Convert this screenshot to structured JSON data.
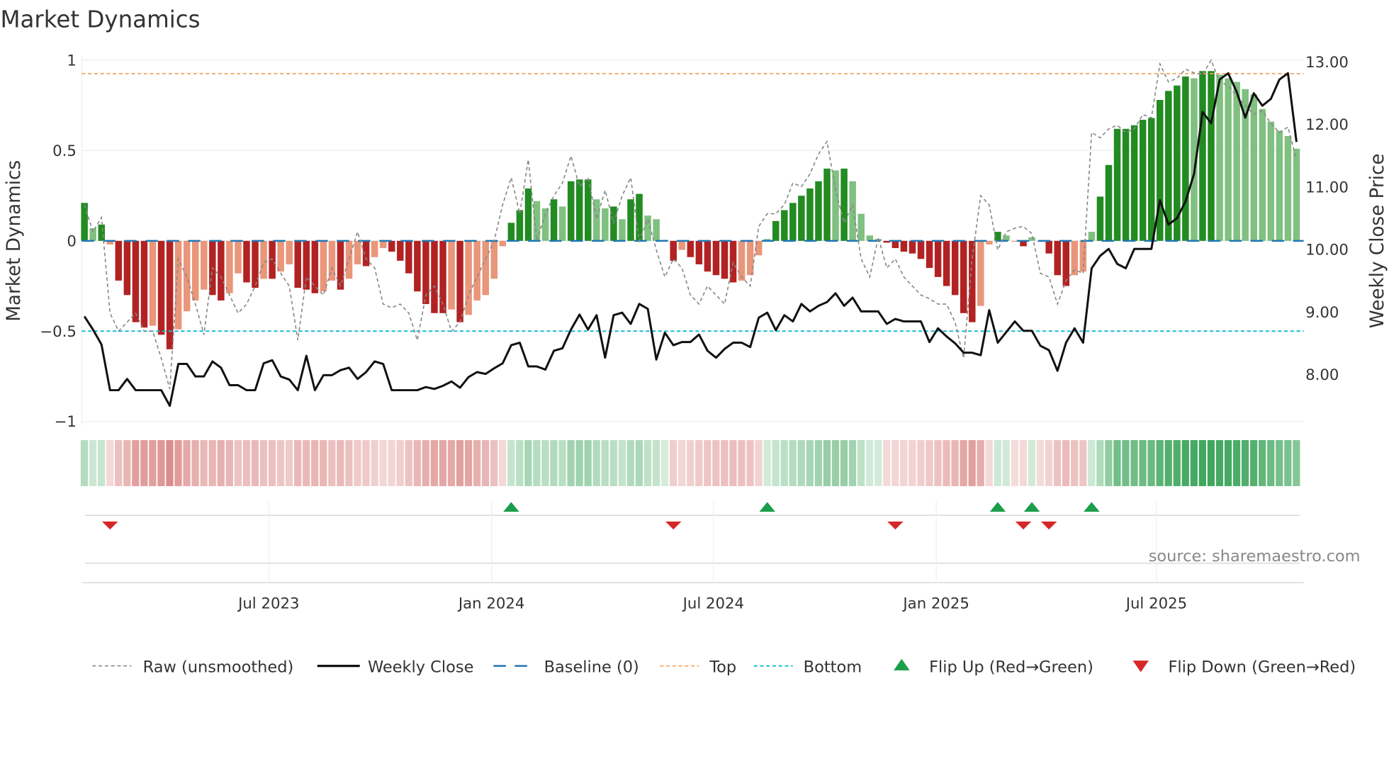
{
  "chart_data": {
    "type": "bar",
    "title": "Market Dynamics",
    "ylabel": "Market Dynamics",
    "y2label": "Weekly Close Price",
    "ylim": [
      -1,
      1
    ],
    "y2lim": [
      7.0,
      13.0
    ],
    "yticks": [
      {
        "v": 1,
        "label": "1"
      },
      {
        "v": 0.5,
        "label": "0.5"
      },
      {
        "v": 0,
        "label": "0"
      },
      {
        "v": -0.5,
        "label": "−0.5"
      },
      {
        "v": -1,
        "label": "−1"
      }
    ],
    "y2ticks": [
      {
        "v": 13,
        "label": "13.00"
      },
      {
        "v": 12,
        "label": "12.00"
      },
      {
        "v": 11,
        "label": "11.00"
      },
      {
        "v": 10,
        "label": "10.00"
      },
      {
        "v": 9,
        "label": "9.00"
      },
      {
        "v": 8,
        "label": "8.00"
      }
    ],
    "xticks": [
      {
        "week": 21.6,
        "label": "Jul 2023"
      },
      {
        "week": 47.7,
        "label": "Jan 2024"
      },
      {
        "week": 73.7,
        "label": "Jul 2024"
      },
      {
        "week": 99.8,
        "label": "Jan 2025"
      },
      {
        "week": 125.6,
        "label": "Jul 2025"
      }
    ],
    "levels": {
      "top": 0.926,
      "bottom": -0.5,
      "baseline": 0
    },
    "market_dynamics": [
      0.21,
      0.07,
      0.09,
      -0.02,
      -0.22,
      -0.3,
      -0.45,
      -0.48,
      -0.47,
      -0.52,
      -0.6,
      -0.49,
      -0.39,
      -0.33,
      -0.27,
      -0.3,
      -0.33,
      -0.29,
      -0.18,
      -0.23,
      -0.26,
      -0.21,
      -0.21,
      -0.17,
      -0.13,
      -0.26,
      -0.27,
      -0.29,
      -0.28,
      -0.22,
      -0.27,
      -0.21,
      -0.13,
      -0.14,
      -0.09,
      -0.04,
      -0.06,
      -0.11,
      -0.18,
      -0.28,
      -0.35,
      -0.4,
      -0.4,
      -0.38,
      -0.45,
      -0.41,
      -0.33,
      -0.3,
      -0.21,
      -0.03,
      0.1,
      0.17,
      0.29,
      0.22,
      0.18,
      0.23,
      0.19,
      0.33,
      0.34,
      0.34,
      0.23,
      0.18,
      0.19,
      0.12,
      0.23,
      0.26,
      0.14,
      0.12,
      0.005,
      -0.11,
      -0.05,
      -0.09,
      -0.13,
      -0.17,
      -0.19,
      -0.21,
      -0.23,
      -0.22,
      -0.19,
      -0.08,
      0.01,
      0.11,
      0.17,
      0.21,
      0.25,
      0.29,
      0.33,
      0.4,
      0.39,
      0.4,
      0.33,
      0.15,
      0.03,
      0.01,
      -0.01,
      -0.04,
      -0.06,
      -0.07,
      -0.1,
      -0.15,
      -0.2,
      -0.25,
      -0.3,
      -0.4,
      -0.45,
      -0.36,
      -0.02,
      0.05,
      0.03,
      -0.005,
      -0.03,
      0.02,
      -0.005,
      -0.07,
      -0.19,
      -0.25,
      -0.19,
      -0.17,
      0.05,
      0.245,
      0.42,
      0.62,
      0.62,
      0.64,
      0.67,
      0.68,
      0.78,
      0.83,
      0.86,
      0.91,
      0.9,
      0.94,
      0.94,
      0.92,
      0.9,
      0.88,
      0.84,
      0.81,
      0.73,
      0.66,
      0.61,
      0.58,
      0.51
    ],
    "raw": [
      0.2,
      0.05,
      0.13,
      -0.4,
      -0.5,
      -0.45,
      -0.4,
      -0.5,
      -0.5,
      -0.65,
      -0.82,
      -0.1,
      -0.2,
      -0.35,
      -0.52,
      -0.15,
      -0.2,
      -0.3,
      -0.4,
      -0.35,
      -0.25,
      -0.12,
      -0.1,
      -0.18,
      -0.25,
      -0.55,
      -0.2,
      -0.25,
      -0.3,
      -0.15,
      -0.25,
      -0.1,
      0.05,
      -0.1,
      -0.15,
      -0.35,
      -0.37,
      -0.35,
      -0.4,
      -0.55,
      -0.3,
      -0.25,
      -0.35,
      -0.5,
      -0.45,
      -0.3,
      -0.2,
      -0.1,
      0.0,
      0.2,
      0.35,
      0.15,
      0.45,
      0.0,
      0.15,
      0.25,
      0.32,
      0.47,
      0.3,
      0.35,
      0.12,
      0.28,
      0.1,
      0.25,
      0.35,
      0.0,
      0.12,
      -0.05,
      -0.2,
      -0.1,
      -0.15,
      -0.3,
      -0.35,
      -0.25,
      -0.3,
      -0.35,
      -0.12,
      -0.2,
      -0.25,
      0.08,
      0.15,
      0.15,
      0.2,
      0.32,
      0.3,
      0.37,
      0.48,
      0.55,
      0.28,
      0.1,
      0.2,
      -0.1,
      -0.2,
      0.02,
      -0.15,
      -0.1,
      -0.2,
      -0.25,
      -0.3,
      -0.32,
      -0.35,
      -0.35,
      -0.45,
      -0.65,
      -0.1,
      0.25,
      0.2,
      -0.05,
      0.05,
      0.07,
      0.08,
      0.04,
      -0.18,
      -0.2,
      -0.35,
      -0.22,
      -0.16,
      -0.18,
      0.6,
      0.57,
      0.62,
      0.64,
      0.6,
      0.62,
      0.7,
      0.68,
      0.98,
      0.88,
      0.9,
      0.95,
      0.93,
      0.92,
      1.0,
      0.88,
      0.86,
      0.8,
      0.75,
      0.7,
      0.72,
      0.65,
      0.6,
      0.63,
      0.45
    ],
    "weekly_close": [
      8.93,
      8.72,
      8.48,
      7.75,
      7.75,
      7.93,
      7.75,
      7.75,
      7.75,
      7.75,
      7.5,
      8.17,
      8.17,
      7.97,
      7.97,
      8.21,
      8.11,
      7.83,
      7.83,
      7.75,
      7.75,
      8.18,
      8.23,
      7.97,
      7.92,
      7.75,
      8.3,
      7.75,
      7.99,
      7.99,
      8.07,
      8.11,
      7.93,
      8.04,
      8.21,
      8.17,
      7.75,
      7.75,
      7.75,
      7.75,
      7.8,
      7.77,
      7.82,
      7.89,
      7.79,
      7.96,
      8.04,
      8.01,
      8.1,
      8.18,
      8.47,
      8.51,
      8.13,
      8.13,
      8.08,
      8.38,
      8.42,
      8.72,
      8.96,
      8.72,
      8.95,
      8.27,
      8.95,
      8.99,
      8.81,
      9.13,
      9.05,
      8.24,
      8.67,
      8.47,
      8.52,
      8.52,
      8.64,
      8.38,
      8.27,
      8.41,
      8.51,
      8.51,
      8.44,
      8.91,
      8.99,
      8.71,
      8.95,
      8.85,
      9.13,
      9.01,
      9.1,
      9.16,
      9.3,
      9.1,
      9.23,
      9.01,
      9.01,
      9.01,
      8.81,
      8.89,
      8.85,
      8.85,
      8.85,
      8.52,
      8.74,
      8.61,
      8.5,
      8.35,
      8.35,
      8.31,
      9.03,
      8.51,
      8.68,
      8.85,
      8.7,
      8.7,
      8.46,
      8.39,
      8.06,
      8.51,
      8.74,
      8.51,
      9.7,
      9.9,
      10.01,
      9.77,
      9.7,
      10.01,
      10.01,
      10.01,
      10.79,
      10.4,
      10.5,
      10.77,
      11.21,
      12.2,
      12.02,
      12.72,
      12.82,
      12.52,
      12.11,
      12.5,
      12.3,
      12.41,
      12.72,
      12.82,
      11.72
    ],
    "flip_up_weeks": [
      50,
      80,
      107,
      111,
      118
    ],
    "flip_down_weeks": [
      3,
      69,
      95,
      110,
      113
    ],
    "legend": [
      {
        "key": "raw",
        "label": "Raw (unsmoothed)"
      },
      {
        "key": "close",
        "label": "Weekly Close"
      },
      {
        "key": "baseline",
        "label": "Baseline (0)"
      },
      {
        "key": "top",
        "label": "Top"
      },
      {
        "key": "bottom",
        "label": "Bottom"
      },
      {
        "key": "up",
        "label": "Flip Up (Red→Green)"
      },
      {
        "key": "down",
        "label": "Flip Down (Green→Red)"
      }
    ],
    "legend_placement": "bottom",
    "source": "source: sharemaestro.com",
    "colors": {
      "green_strong": "#228b22",
      "green_weak": "#80c080",
      "red_strong": "#b22222",
      "red_weak": "#e9967a",
      "close": "#111111",
      "raw": "#888888",
      "baseline": "#1f77b4",
      "top": "#f4a460",
      "bottom": "#17becf",
      "up": "#1a9e4a",
      "down": "#d62728"
    }
  }
}
